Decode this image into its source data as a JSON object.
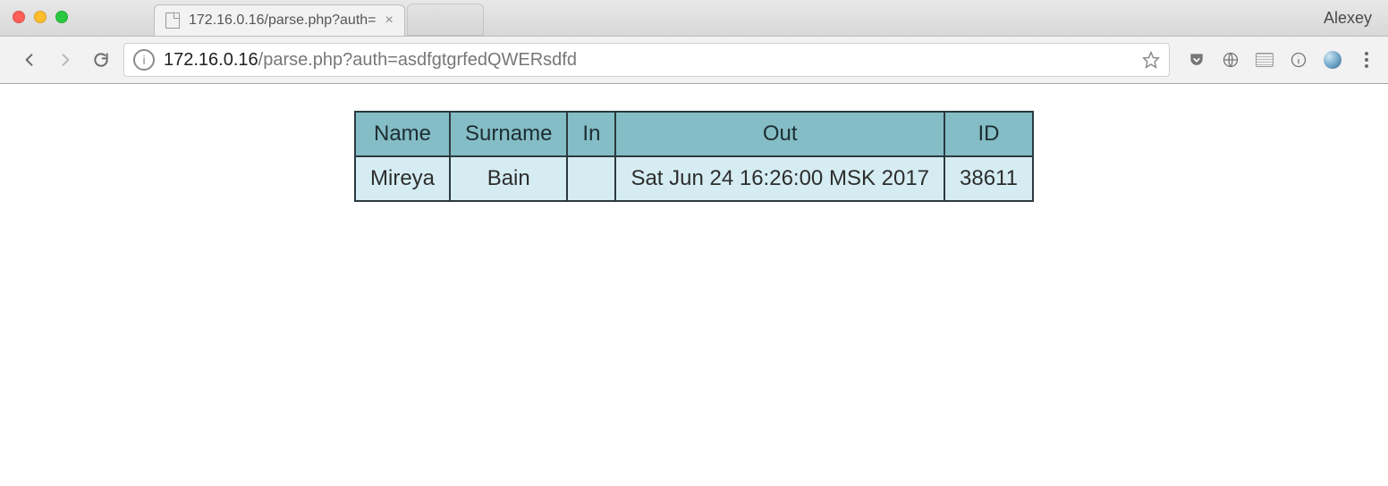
{
  "window": {
    "profile_name": "Alexey"
  },
  "tabs": {
    "active_title": "172.16.0.16/parse.php?auth="
  },
  "address_bar": {
    "host": "172.16.0.16",
    "path": "/parse.php?auth=asdfgtgrfedQWERsdfd"
  },
  "table": {
    "headers": [
      "Name",
      "Surname",
      "In",
      "Out",
      "ID"
    ],
    "rows": [
      {
        "name": "Mireya",
        "surname": "Bain",
        "in": "",
        "out": "Sat Jun 24 16:26:00 MSK 2017",
        "id": "38611"
      }
    ]
  }
}
